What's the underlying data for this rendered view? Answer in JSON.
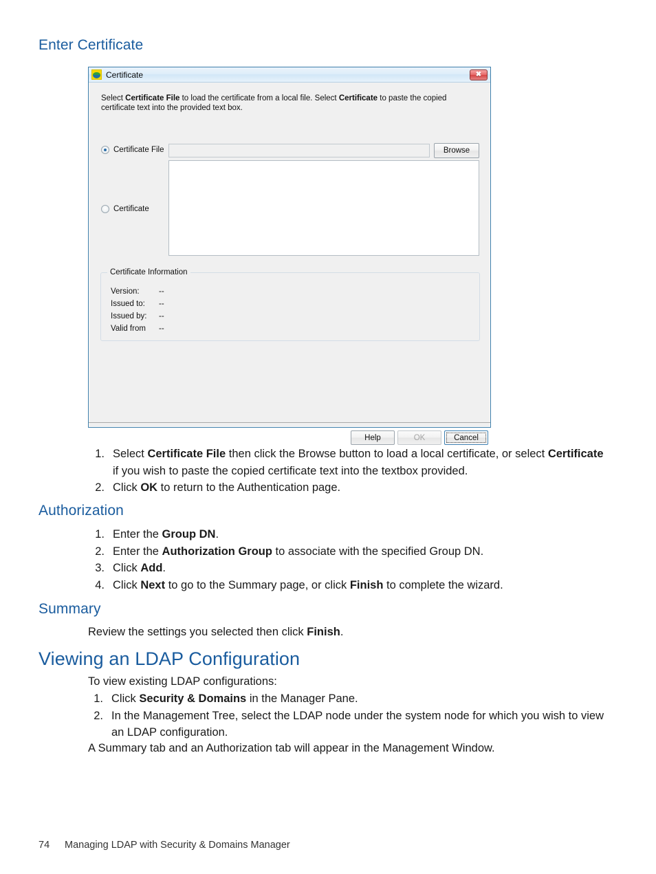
{
  "page": {
    "footer": {
      "page_number": "74",
      "title": "Managing LDAP with Security & Domains Manager"
    },
    "sections": {
      "enter_certificate": {
        "heading": "Enter Certificate"
      },
      "authorization": {
        "heading": "Authorization"
      },
      "summary": {
        "heading": "Summary",
        "paragraph_prefix": "Review the settings you selected then click ",
        "paragraph_bold": "Finish",
        "paragraph_suffix": "."
      },
      "viewing_ldap": {
        "heading": "Viewing an LDAP Configuration",
        "intro": "To view existing LDAP configurations:",
        "closing": "A Summary tab and an Authorization tab will appear in the Management Window."
      }
    },
    "cert_steps": [
      {
        "num": "1.",
        "p1": "Select ",
        "b1": "Certificate File",
        "p2": " then click the Browse button to load a local certificate, or select ",
        "b2": "Certificate",
        "p3": " if you wish to paste the copied certificate text into the textbox provided."
      },
      {
        "num": "2.",
        "p1": "Click ",
        "b1": "OK",
        "p2": " to return to the Authentication page.",
        "b2": "",
        "p3": ""
      }
    ],
    "authorization_steps": [
      {
        "num": "1.",
        "p1": "Enter the ",
        "b1": "Group DN",
        "p2": ".",
        "b2": "",
        "p3": ""
      },
      {
        "num": "2.",
        "p1": "Enter the ",
        "b1": "Authorization Group",
        "p2": " to associate with the specified Group DN.",
        "b2": "",
        "p3": ""
      },
      {
        "num": "3.",
        "p1": "Click ",
        "b1": "Add",
        "p2": ".",
        "b2": "",
        "p3": ""
      },
      {
        "num": "4.",
        "p1": "Click ",
        "b1": "Next",
        "p2": " to go to the Summary page, or click ",
        "b2": "Finish",
        "p3": " to complete the wizard."
      }
    ],
    "viewing_steps": [
      {
        "num": "1.",
        "p1": "Click ",
        "b1": "Security & Domains",
        "p2": " in the Manager Pane.",
        "b2": "",
        "p3": ""
      },
      {
        "num": "2.",
        "p1": "In the Management Tree, select the LDAP node under the system node for which you wish to view an LDAP configuration.",
        "b1": "",
        "p2": "",
        "b2": "",
        "p3": ""
      }
    ]
  },
  "dialog": {
    "title": "Certificate",
    "icon": "certificate-globe-icon",
    "close_glyph": "✖",
    "description_parts": {
      "p1": "Select ",
      "b1": "Certificate File",
      "p2": " to load the certificate from a local file. Select ",
      "b2": "Certificate",
      "p3": " to paste the copied certificate text into the provided text box."
    },
    "radio_certificate_file": {
      "label": "Certificate File",
      "selected": true
    },
    "radio_certificate": {
      "label": "Certificate",
      "selected": false
    },
    "file_field": {
      "value": "",
      "placeholder": ""
    },
    "textarea": {
      "value": "",
      "placeholder": ""
    },
    "browse_button": "Browse",
    "group": {
      "title": "Certificate Information",
      "rows": [
        {
          "label": "Version:",
          "value": "--"
        },
        {
          "label": "Issued to:",
          "value": "--"
        },
        {
          "label": "Issued by:",
          "value": "--"
        },
        {
          "label": "Valid from",
          "value": "--"
        }
      ]
    },
    "buttons": {
      "help": "Help",
      "ok": "OK",
      "cancel": "Cancel"
    },
    "colors": {
      "heading_blue": "#1a5c9e",
      "dialog_border": "#3d7eaa",
      "dialog_bg": "#f0f0f0",
      "close_red": "#d84545",
      "radio_dot": "#2b6ea8"
    }
  }
}
